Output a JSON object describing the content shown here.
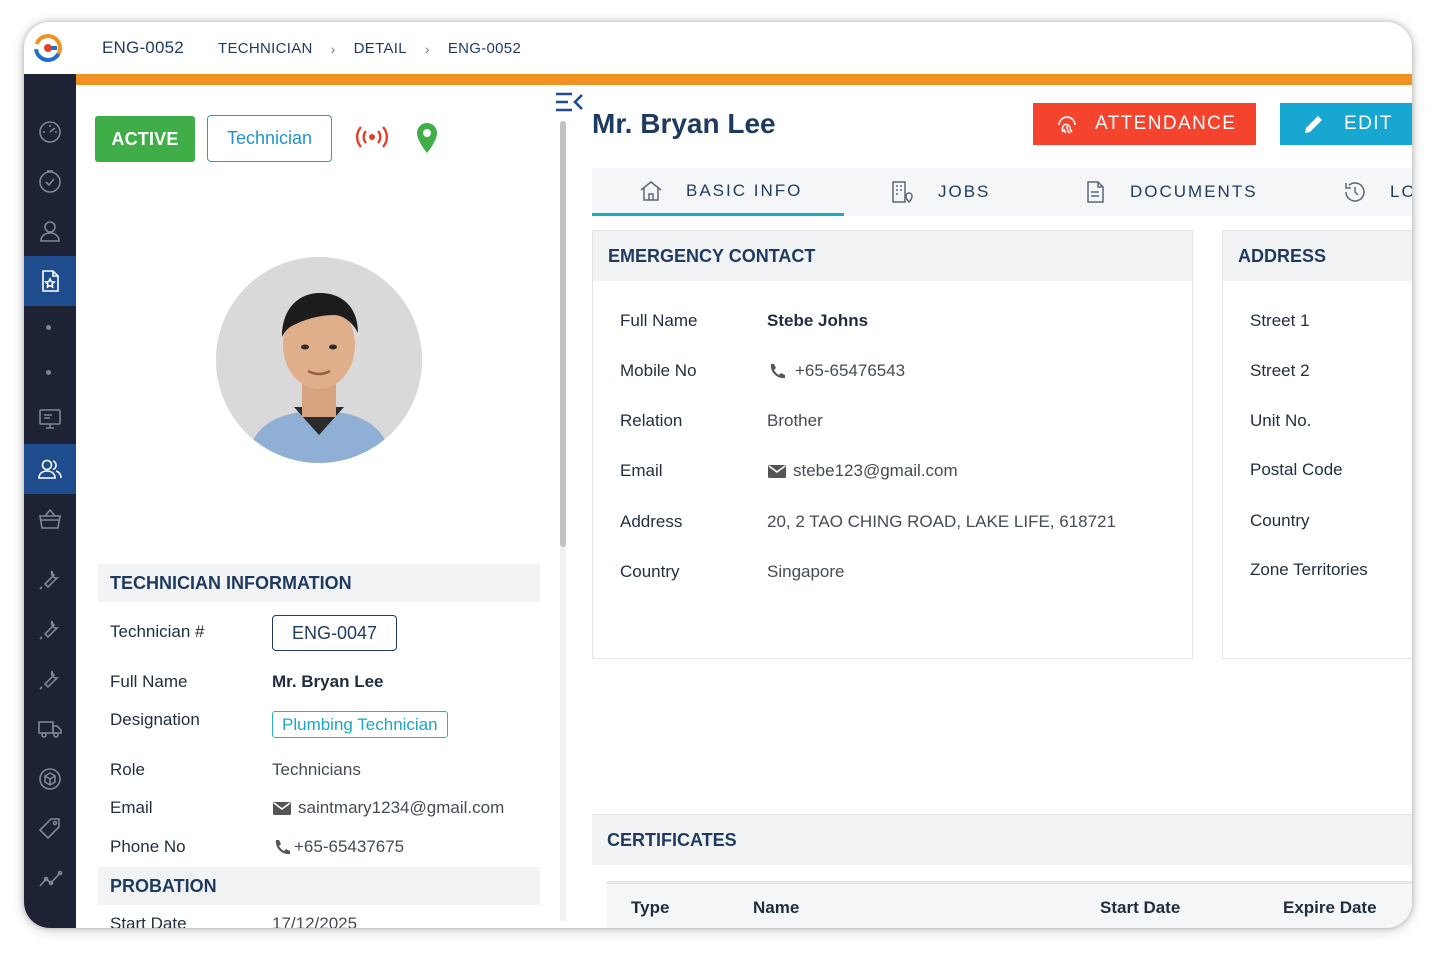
{
  "header": {
    "record_id": "ENG-0052",
    "breadcrumb": [
      "TECHNICIAN",
      "DETAIL",
      "ENG-0052"
    ]
  },
  "colors": {
    "accent_orange": "#f39224",
    "sidebar_bg": "#1e2235",
    "sidebar_active": "#1e4c8c",
    "active_green": "#3fae49",
    "attendance_red": "#f4442e",
    "edit_blue": "#17a7d1",
    "heading_navy": "#1f3a5f"
  },
  "sidebar": {
    "items": [
      "dashboard-gauge-icon",
      "timer-check-icon",
      "user-icon",
      "document-star-icon",
      "dot",
      "dot",
      "monitor-icon",
      "users-icon",
      "basket-icon",
      "wrench-icon",
      "wrench-icon",
      "wrench-icon",
      "truck-icon",
      "box-icon",
      "tag-icon",
      "chart-line-icon"
    ],
    "active": [
      "document-star-icon",
      "users-icon"
    ]
  },
  "profile": {
    "status_badge": "ACTIVE",
    "type_badge": "Technician",
    "title": "Mr. Bryan Lee"
  },
  "tech_info": {
    "heading": "TECHNICIAN INFORMATION",
    "technician_no_label": "Technician #",
    "technician_no": "ENG-0047",
    "full_name_label": "Full Name",
    "full_name": "Mr. Bryan Lee",
    "designation_label": "Designation",
    "designation": "Plumbing Technician",
    "role_label": "Role",
    "role": "Technicians",
    "email_label": "Email",
    "email": "saintmary1234@gmail.com",
    "phone_label": "Phone No",
    "phone": "+65-65437675"
  },
  "probation": {
    "heading": "PROBATION",
    "start_label": "Start Date",
    "start_date": "17/12/2025"
  },
  "actions": {
    "attendance": "ATTENDANCE",
    "edit": "EDIT"
  },
  "tabs": [
    {
      "label": "BASIC INFO",
      "icon": "home-icon",
      "active": true
    },
    {
      "label": "JOBS",
      "icon": "building-pin-icon",
      "active": false
    },
    {
      "label": "DOCUMENTS",
      "icon": "document-icon",
      "active": false
    },
    {
      "label": "LO",
      "icon": "history-icon",
      "active": false
    }
  ],
  "emergency": {
    "heading": "EMERGENCY CONTACT",
    "full_name_label": "Full Name",
    "full_name": "Stebe Johns",
    "mobile_label": "Mobile No",
    "mobile": "+65-65476543",
    "relation_label": "Relation",
    "relation": "Brother",
    "email_label": "Email",
    "email": "stebe123@gmail.com",
    "address_label": "Address",
    "address": "20, 2 TAO CHING ROAD, LAKE LIFE, 618721",
    "country_label": "Country",
    "country": "Singapore"
  },
  "address": {
    "heading": "ADDRESS",
    "labels": [
      "Street 1",
      "Street 2",
      "Unit No.",
      "Postal Code",
      "Country",
      "Zone Territories"
    ]
  },
  "certificates": {
    "heading": "CERTIFICATES",
    "columns": [
      "Type",
      "Name",
      "Start Date",
      "Expire Date"
    ]
  }
}
